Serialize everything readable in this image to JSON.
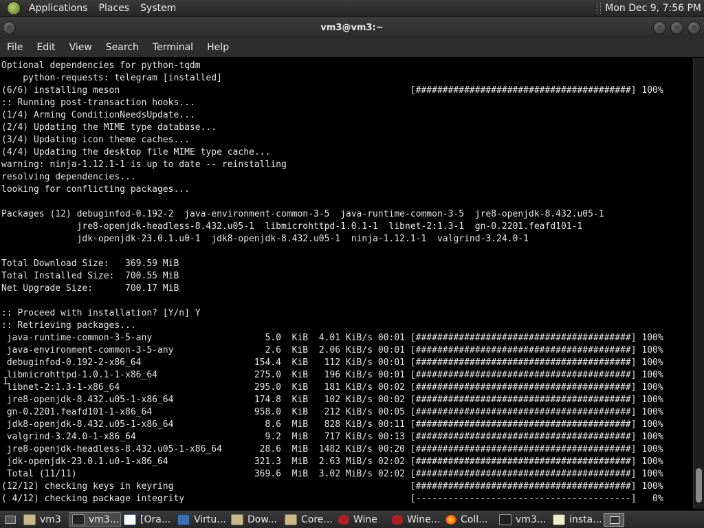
{
  "top_panel": {
    "menus": [
      "Applications",
      "Places",
      "System"
    ],
    "clock": "Mon Dec 9, 7:56 PM"
  },
  "window": {
    "title": "vm3@vm3:~",
    "menubar": [
      "File",
      "Edit",
      "View",
      "Search",
      "Terminal",
      "Help"
    ]
  },
  "terminal": {
    "lines": [
      "Optional dependencies for python-tqdm",
      "    python-requests: telegram [installed]",
      "(6/6) installing meson                                                      [########################################] 100%",
      ":: Running post-transaction hooks...",
      "(1/4) Arming ConditionNeedsUpdate...",
      "(2/4) Updating the MIME type database...",
      "(3/4) Updating icon theme caches...",
      "(4/4) Updating the desktop file MIME type cache...",
      "warning: ninja-1.12.1-1 is up to date -- reinstalling",
      "resolving dependencies...",
      "looking for conflicting packages...",
      "",
      "Packages (12) debuginfod-0.192-2  java-environment-common-3-5  java-runtime-common-3-5  jre8-openjdk-8.432.u05-1",
      "              jre8-openjdk-headless-8.432.u05-1  libmicrohttpd-1.0.1-1  libnet-2:1.3-1  gn-0.2201.feafd101-1",
      "              jdk-openjdk-23.0.1.u0-1  jdk8-openjdk-8.432.u05-1  ninja-1.12.1-1  valgrind-3.24.0-1",
      "",
      "Total Download Size:   369.59 MiB",
      "Total Installed Size:  700.55 MiB",
      "Net Upgrade Size:      700.17 MiB",
      "",
      ":: Proceed with installation? [Y/n] Y",
      ":: Retrieving packages...",
      " java-runtime-common-3-5-any                     5.0  KiB  4.01 KiB/s 00:01 [########################################] 100%",
      " java-environment-common-3-5-any                 2.6  KiB  2.06 KiB/s 00:01 [########################################] 100%",
      " debuginfod-0.192-2-x86_64                     154.4  KiB   112 KiB/s 00:01 [########################################] 100%",
      " libmicrohttpd-1.0.1-1-x86_64                  275.0  KiB   196 KiB/s 00:01 [########################################] 100%",
      " libnet-2:1.3-1-x86_64                         295.0  KiB   181 KiB/s 00:02 [########################################] 100%",
      " jre8-openjdk-8.432.u05-1-x86_64               174.8  KiB   102 KiB/s 00:02 [########################################] 100%",
      " gn-0.2201.feafd101-1-x86_64                   958.0  KiB   212 KiB/s 00:05 [########################################] 100%",
      " jdk8-openjdk-8.432.u05-1-x86_64                 8.6  MiB   828 KiB/s 00:11 [########################################] 100%",
      " valgrind-3.24.0-1-x86_64                        9.2  MiB   717 KiB/s 00:13 [########################################] 100%",
      " jre8-openjdk-headless-8.432.u05-1-x86_64       28.6  MiB  1482 KiB/s 00:20 [########################################] 100%",
      " jdk-openjdk-23.0.1.u0-1-x86_64                321.3  MiB  2.63 MiB/s 02:02 [########################################] 100%",
      " Total (11/11)                                 369.6  MiB  3.02 MiB/s 02:02 [########################################] 100%",
      "(12/12) checking keys in keyring                                            [########################################] 100%",
      "( 4/12) checking package integrity                                          [----------------------------------------]   0%"
    ]
  },
  "taskbar": {
    "tasks": [
      {
        "label": "vm3",
        "icon": "folder-icon"
      },
      {
        "label": "vm3...",
        "icon": "terminal-icon"
      },
      {
        "label": "[Ora...",
        "icon": "oracle-icon"
      },
      {
        "label": "Virtu...",
        "icon": "virtualbox-icon"
      },
      {
        "label": "Dow...",
        "icon": "folder-icon"
      },
      {
        "label": "Core...",
        "icon": "folder-icon"
      },
      {
        "label": "Wine",
        "icon": "wine-icon"
      },
      {
        "label": "Wine...",
        "icon": "wine-icon"
      },
      {
        "label": "Coll...",
        "icon": "firefox-icon"
      },
      {
        "label": "vm3...",
        "icon": "terminal-icon"
      },
      {
        "label": "insta...",
        "icon": "text-editor-icon"
      }
    ]
  }
}
